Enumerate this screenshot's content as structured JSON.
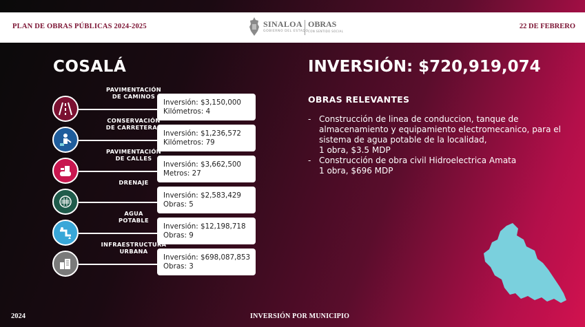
{
  "header": {
    "left_title": "PLAN DE OBRAS PÚBLICAS 2024-2025",
    "logo_brand": "SINALOA",
    "logo_sub": "GOBIERNO DEL ESTADO",
    "logo_dept": "OBRAS",
    "logo_dept_sub": "CON SENTIDO SOCIAL",
    "date": "22 DE FEBRERO"
  },
  "municipio": "COSALÁ",
  "inversion_total": "INVERSIÓN: $720,919,074",
  "obras_relevantes": {
    "title": "OBRAS RELEVANTES",
    "items": [
      "Construcción de linea de conduccion, tanque de almacenamiento y equipamiento electromecanico, para el sistema de agua potable de la localidad,\n1 obra, $3.5 MDP",
      "Construcción de obra civil Hidroelectrica Amata\n1 obra, $696 MDP"
    ]
  },
  "categorias": [
    {
      "label": "PAVIMENTACIÓN\nDE CAMINOS",
      "line1": "Inversión: $3,150,000",
      "line2": "Kilómetros: 4",
      "icon": "road-icon",
      "color": "#7a1131"
    },
    {
      "label": "CONSERVACIÓN\nDE CARRETERAS",
      "line1": "Inversión: $1,236,572",
      "line2": "Kilómetros: 79",
      "icon": "worker-icon",
      "color": "#1f5d9c"
    },
    {
      "label": "PAVIMENTACIÓN\nDE CALLES",
      "line1": "Inversión: $3,662,500",
      "line2": "Metros: 27",
      "icon": "roller-icon",
      "color": "#c8174f"
    },
    {
      "label": "DRENAJE",
      "line1": "Inversión: $2,583,429",
      "line2": "Obras: 5",
      "icon": "drain-icon",
      "color": "#1f5b4b"
    },
    {
      "label": "AGUA\nPOTABLE",
      "line1": "Inversión: $12,198,718",
      "line2": "Obras: 9",
      "icon": "water-pipe-icon",
      "color": "#39a7d8"
    },
    {
      "label": "INFRAESTRUCTURA\nURBANA",
      "line1": "Inversión: $698,087,853",
      "line2": "Obras: 3",
      "icon": "buildings-icon",
      "color": "#7a7a7a"
    }
  ],
  "map": {
    "icon": "municipality-map-icon",
    "color": "#7ad0dd"
  },
  "footer": {
    "year": "2024",
    "center": "INVERSIÓN POR MUNICIPIO"
  }
}
